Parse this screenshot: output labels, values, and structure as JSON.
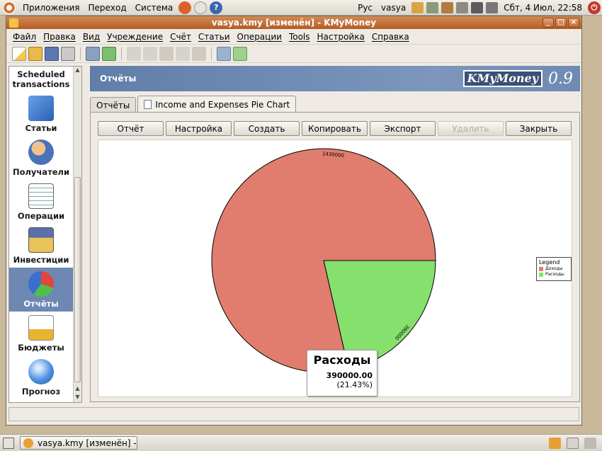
{
  "top_panel": {
    "menus": [
      "Приложения",
      "Переход",
      "Система"
    ],
    "keyboard_layout": "Рус",
    "user": "vasya",
    "clock": "Сбт, 4 Июл, 22:58"
  },
  "window": {
    "title": "vasya.kmy [изменён] - KMyMoney"
  },
  "menubar": [
    "Файл",
    "Правка",
    "Вид",
    "Учреждение",
    "Счёт",
    "Статьи",
    "Операции",
    "Tools",
    "Настройка",
    "Справка"
  ],
  "sidebar": {
    "items": [
      {
        "label": "Scheduled transactions",
        "icon": "calendar-icon"
      },
      {
        "label": "Статьи",
        "icon": "categories-icon"
      },
      {
        "label": "Получатели",
        "icon": "payees-icon"
      },
      {
        "label": "Операции",
        "icon": "ledger-icon"
      },
      {
        "label": "Инвестиции",
        "icon": "investments-icon"
      },
      {
        "label": "Отчёты",
        "icon": "reports-icon"
      },
      {
        "label": "Бюджеты",
        "icon": "budgets-icon"
      },
      {
        "label": "Прогноз",
        "icon": "forecast-icon"
      }
    ],
    "active": "Отчёты"
  },
  "header": {
    "title": "Отчёты",
    "logo": "KMyMoney",
    "version": "0.9"
  },
  "tabs": [
    {
      "label": "Отчёты",
      "active": false
    },
    {
      "label": "Income and Expenses Pie Chart",
      "active": true
    }
  ],
  "buttons": {
    "report": "Отчёт",
    "configure": "Настройка",
    "create": "Создать",
    "copy": "Копировать",
    "export": "Экспорт",
    "delete": "Удалить",
    "close": "Закрыть"
  },
  "chart_data": {
    "type": "pie",
    "categories": [
      "Доходы",
      "Расходы"
    ],
    "values": [
      1430000,
      390000
    ],
    "slice_labels": [
      "1430000",
      "390000"
    ],
    "colors": [
      "#e07d6e",
      "#86e06e"
    ],
    "legend": {
      "title": "Legend",
      "placement": "right"
    },
    "tooltip": {
      "name": "Расходы",
      "value": "390000.00",
      "percent": "(21.43%)"
    }
  },
  "taskbar": {
    "task": "vasya.kmy [изменён] -..."
  }
}
